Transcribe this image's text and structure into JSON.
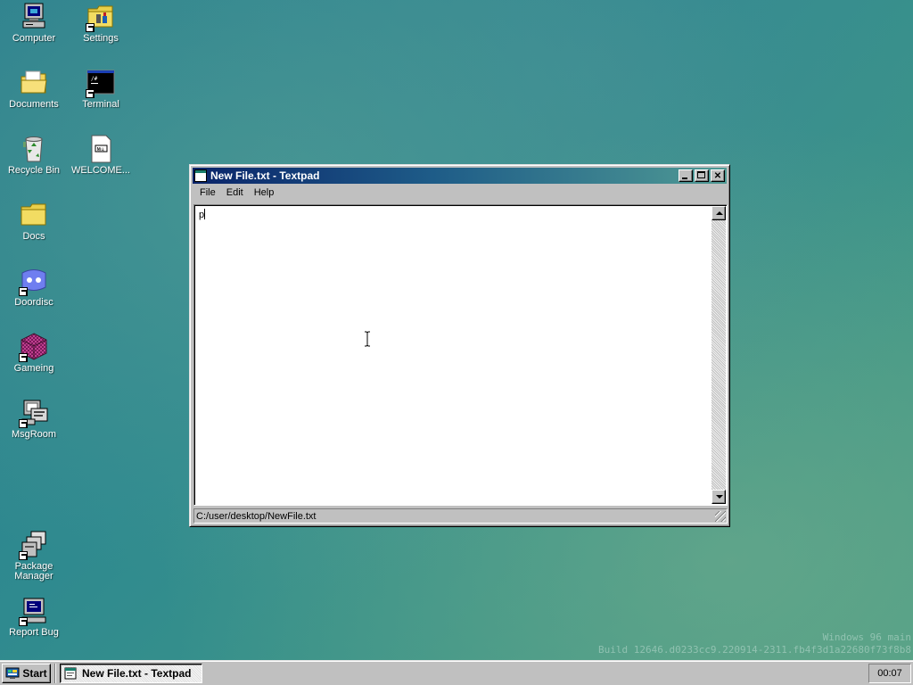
{
  "desktop": {
    "icons": [
      {
        "label": "Computer",
        "icon": "computer-icon"
      },
      {
        "label": "Settings",
        "icon": "settings-folder-icon"
      },
      {
        "label": "Documents",
        "icon": "documents-folder-icon"
      },
      {
        "label": "Terminal",
        "icon": "terminal-icon"
      },
      {
        "label": "Recycle Bin",
        "icon": "recycle-bin-icon"
      },
      {
        "label": "WELCOME...",
        "icon": "markdown-file-icon"
      },
      {
        "label": "Docs",
        "icon": "folder-icon"
      },
      {
        "label": "Doordisc",
        "icon": "doordisc-icon"
      },
      {
        "label": "Gameing",
        "icon": "gameing-icon"
      },
      {
        "label": "MsgRoom",
        "icon": "msgroom-icon"
      },
      {
        "label": "Package Manager",
        "icon": "package-manager-icon"
      },
      {
        "label": "Report Bug",
        "icon": "report-bug-icon"
      }
    ],
    "watermark": {
      "line1": "Windows 96 main",
      "line2": "Build 12646.d0233cc9.220914-2311.fb4f3d1a22680f73f8b8"
    }
  },
  "window": {
    "title": "New File.txt - Textpad",
    "menu": [
      "File",
      "Edit",
      "Help"
    ],
    "editor_text": "p",
    "status_path": "C:/user/desktop/NewFile.txt",
    "controls": {
      "minimize": "_",
      "maximize": "□",
      "close": "✕"
    }
  },
  "taskbar": {
    "start_label": "Start",
    "task_label": "New File.txt - Textpad",
    "clock": "00:07"
  },
  "colors": {
    "title_start": "#0a246a",
    "title_end": "#4f9a94",
    "face": "#c0c0c0",
    "desktop": "#2f8a8f"
  }
}
